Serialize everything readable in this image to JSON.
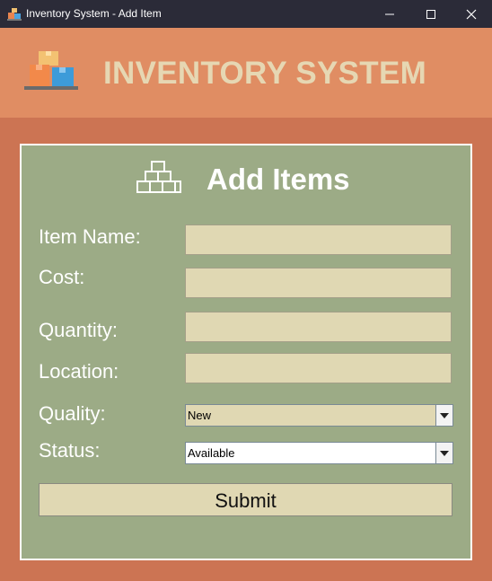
{
  "window": {
    "title": "Inventory System - Add Item",
    "icon": "boxes-app-icon",
    "controls": [
      "minimize-icon",
      "maximize-icon",
      "close-icon"
    ]
  },
  "header": {
    "logo_icon": "stacked-boxes-logo",
    "app_name": "INVENTORY SYSTEM"
  },
  "form": {
    "title": "Add Items",
    "title_icon": "box-pile-icon",
    "fields": {
      "item_name": {
        "label": "Item Name:",
        "value": ""
      },
      "cost": {
        "label": "Cost:",
        "value": ""
      },
      "quantity": {
        "label": "Quantity:",
        "value": ""
      },
      "location": {
        "label": "Location:",
        "value": ""
      }
    },
    "quality": {
      "label": "Quality:",
      "selected": "New"
    },
    "status": {
      "label": "Status:",
      "selected": "Available"
    },
    "submit_label": "Submit"
  },
  "colors": {
    "titlebar": "#2b2b38",
    "header": "#e08d63",
    "background": "#cc7453",
    "panel": "#9cab86",
    "input": "#e0d8b3",
    "header_text": "#e6d7b3"
  }
}
